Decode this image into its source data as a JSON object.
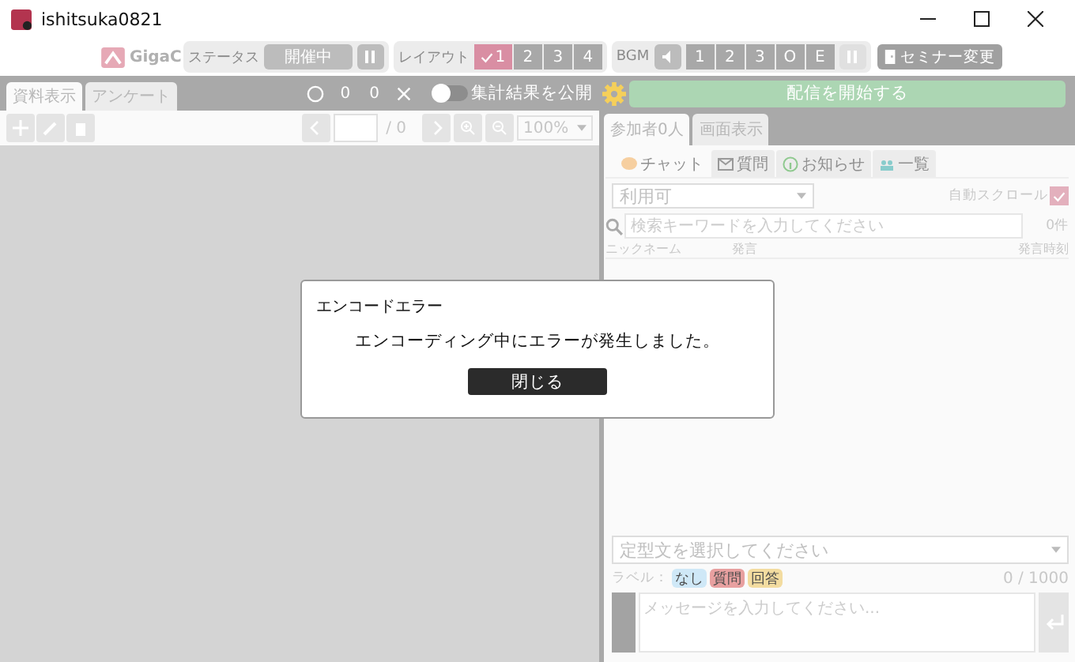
{
  "window": {
    "title": "ishitsuka0821"
  },
  "toolbar": {
    "logo": "GigaC",
    "status_label": "ステータス",
    "status": "開催中",
    "layout_label": "レイアウト",
    "layouts": [
      {
        "label": "1",
        "selected": true
      },
      {
        "label": "2",
        "selected": false
      },
      {
        "label": "3",
        "selected": false
      },
      {
        "label": "4",
        "selected": false
      }
    ],
    "bgm_label": "BGM",
    "bgm_tracks": [
      "1",
      "2",
      "3",
      "O",
      "E"
    ],
    "seminar_button": "セミナー変更"
  },
  "left_tabs": [
    {
      "label": "資料表示",
      "selected": true
    },
    {
      "label": "アンケート",
      "selected": false
    }
  ],
  "poll": {
    "correct": "0",
    "wrong": "0"
  },
  "publish_toggle": {
    "label": "集計結果を公開",
    "on": false
  },
  "start_button": "配信を開始する",
  "pager": {
    "total": "/ 0",
    "zoom": "100%"
  },
  "right_tabs": [
    {
      "label": "参加者0人",
      "selected": true
    },
    {
      "label": "画面表示",
      "selected": false
    }
  ],
  "chat_tabs": [
    {
      "kind": "chat",
      "label": "チャット",
      "selected": true
    },
    {
      "kind": "question",
      "label": "質問",
      "selected": false
    },
    {
      "kind": "notice",
      "label": "お知らせ",
      "selected": false
    },
    {
      "kind": "list",
      "label": "一覧",
      "selected": false
    }
  ],
  "filter": "利用可",
  "auto_scroll": {
    "label": "自動スクロール",
    "checked": true
  },
  "search": {
    "placeholder": "検索キーワードを入力してください"
  },
  "count": "0件",
  "columns": [
    "ニックネーム",
    "発言",
    "発言時刻"
  ],
  "template_select": {
    "placeholder": "定型文を選択してください"
  },
  "label_caption": "ラベル：",
  "labels": [
    {
      "label": "なし",
      "color": "#cfe8f7"
    },
    {
      "label": "質問",
      "color": "#e8a0a0"
    },
    {
      "label": "回答",
      "color": "#f3dca0"
    }
  ],
  "char_count": "0 / 1000",
  "message": {
    "placeholder": "メッセージを入力してください..."
  },
  "dialog": {
    "title": "エンコードエラー",
    "message": "エンコーディング中にエラーが発生しました。",
    "button": "閉じる"
  }
}
